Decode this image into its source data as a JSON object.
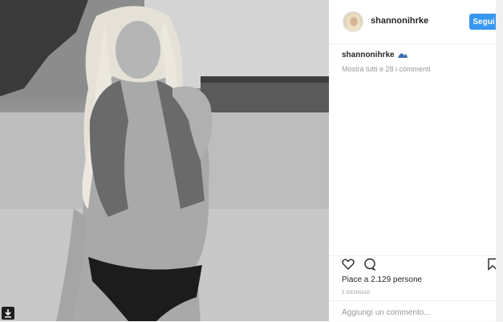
{
  "post": {
    "username": "shannonihrke",
    "follow_label": "Segui",
    "caption_user": "shannonihrke",
    "caption_icon": "wave-icon",
    "view_comments": "Mostra tutti e 28 i commenti",
    "likes": "Piace a 2.129 persone",
    "date": "2 GENNAIO",
    "comment_placeholder": "Aggiungi un commento..."
  },
  "icons": {
    "like": "heart-icon",
    "comment": "comment-icon",
    "save": "bookmark-icon",
    "download": "download-icon"
  },
  "colors": {
    "accent": "#3897f0",
    "muted": "#999999",
    "text": "#262626"
  }
}
